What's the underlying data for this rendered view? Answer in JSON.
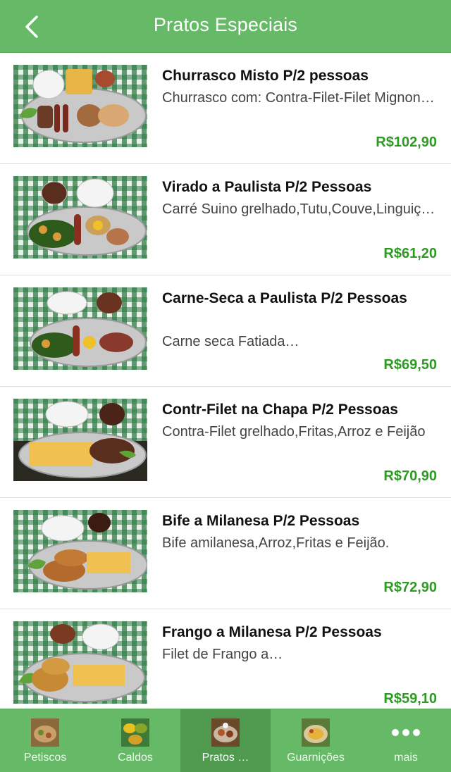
{
  "header": {
    "title": "Pratos Especiais",
    "back_icon": "chevron-left-icon"
  },
  "dishes": [
    {
      "title": "Churrasco Misto P/2 pessoas",
      "description": "Churrasco com: Contra-Filet-Filet Mignon-Picanha-Frango",
      "price": "R$102,90"
    },
    {
      "title": "Virado a Paulista P/2 Pessoas",
      "description": "Carré Suino grelhado,Tutu,Couve,Linguiça,Ovo",
      "price": "R$61,20"
    },
    {
      "title": "Carne-Seca a Paulista P/2 Pessoas",
      "description": "Carne seca Fatiada…",
      "price": "R$69,50"
    },
    {
      "title": "Contr-Filet na Chapa P/2 Pessoas",
      "description": "Contra-Filet grelhado,Fritas,Arroz e Feijão",
      "price": "R$70,90"
    },
    {
      "title": "Bife a Milanesa P/2 Pessoas",
      "description": "Bife amilanesa,Arroz,Fritas e Feijão.",
      "price": "R$72,90"
    },
    {
      "title": "Frango a Milanesa P/2 Pessoas",
      "description": "Filet de Frango a…",
      "price": "R$59,10"
    }
  ],
  "tabs": [
    {
      "label": "Petiscos",
      "icon": "petiscos-icon",
      "active": false
    },
    {
      "label": "Caldos",
      "icon": "caldos-icon",
      "active": false
    },
    {
      "label": "Pratos …",
      "icon": "pratos-icon",
      "active": true
    },
    {
      "label": "Guarnições",
      "icon": "guarnicoes-icon",
      "active": false
    },
    {
      "label": "mais",
      "icon": "more-dots-icon",
      "active": false
    }
  ],
  "colors": {
    "bar_green": "#66b966",
    "active_tab": "#4f9a4f",
    "price_green": "#2e9a24"
  }
}
